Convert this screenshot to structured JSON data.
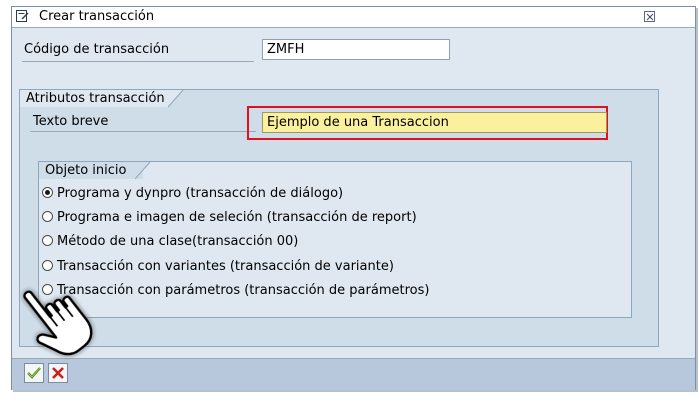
{
  "dialog": {
    "title": "Crear transacción",
    "title_icon": "create-document-icon",
    "close_icon": "close-icon"
  },
  "transaction_code": {
    "label": "Código de transacción",
    "value": "ZMFH"
  },
  "attributes_group": {
    "title": "Atributos transacción",
    "short_text": {
      "label": "Texto breve",
      "value": "Ejemplo de una Transaccion"
    }
  },
  "start_object": {
    "title": "Objeto inicio",
    "options": [
      {
        "label": "Programa y dynpro (transacción de diálogo)",
        "selected": true
      },
      {
        "label": "Programa e imagen de seleción (transacción de report)",
        "selected": false
      },
      {
        "label": "Método de una clase(transacción 00)",
        "selected": false
      },
      {
        "label": "Transacción con variantes (transacción de variante)",
        "selected": false
      },
      {
        "label": "Transacción con parámetros (transacción de parámetros)",
        "selected": false
      }
    ]
  },
  "footer": {
    "confirm_icon": "checkmark-icon",
    "cancel_icon": "cancel-x-icon"
  },
  "colors": {
    "highlight_border": "#e01020",
    "input_highlight_bg": "#fbf09e",
    "dialog_bg": "#dfe8f1"
  }
}
